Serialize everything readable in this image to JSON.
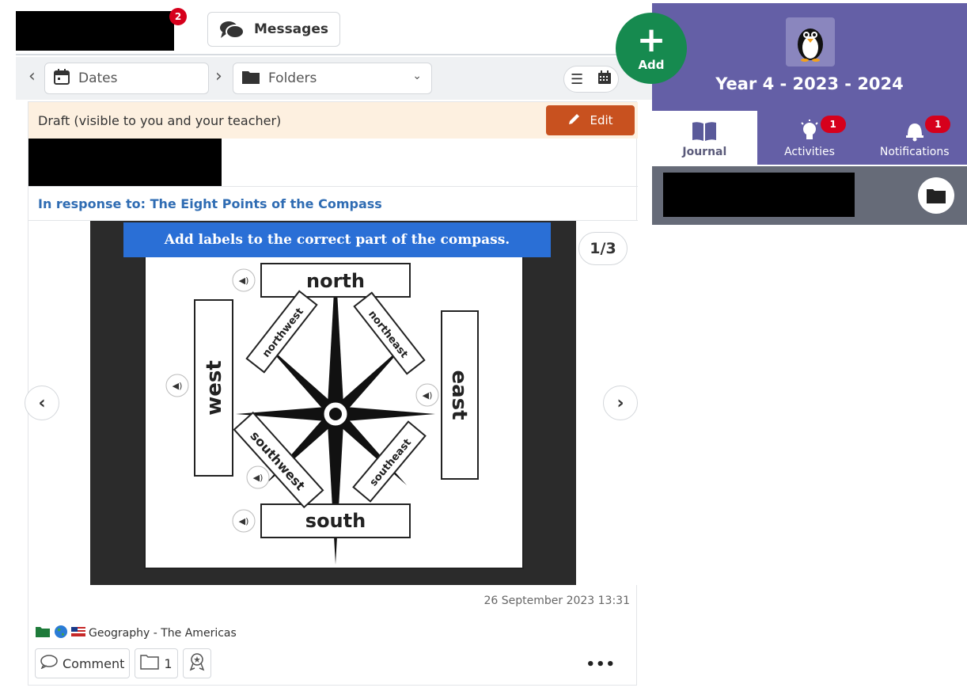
{
  "topbar": {
    "notification_count": "2",
    "messages_label": "Messages"
  },
  "filters": {
    "dates_label": "Dates",
    "folders_label": "Folders"
  },
  "add_button": {
    "label": "Add"
  },
  "post": {
    "draft_text": "Draft (visible to you and your teacher)",
    "edit_label": "Edit",
    "response_text": "In response to: The Eight Points of the Compass",
    "slide_title": "Add labels to the correct part of the compass.",
    "slide_counter": "1/3",
    "compass_labels": {
      "north": "north",
      "south": "south",
      "east": "east",
      "west": "west",
      "northwest": "northwest",
      "northeast": "northeast",
      "southwest": "southwest",
      "southeast": "southeast"
    },
    "timestamp": "26 September 2023 13:31",
    "tag_label": "Geography - The Americas",
    "comment_label": "Comment",
    "folder_count": "1",
    "more_label": "•••"
  },
  "class_panel": {
    "title": "Year 4 - 2023 - 2024",
    "tabs": [
      {
        "label": "Journal",
        "badge": ""
      },
      {
        "label": "Activities",
        "badge": "1"
      },
      {
        "label": "Notifications",
        "badge": "1"
      }
    ]
  },
  "colors": {
    "panel_purple": "#645fa6",
    "add_green": "#168a4f",
    "edit_orange": "#c8511f",
    "badge_red": "#d6001c",
    "link_blue": "#2f6cb3",
    "slide_blue": "#2a6fd6"
  }
}
